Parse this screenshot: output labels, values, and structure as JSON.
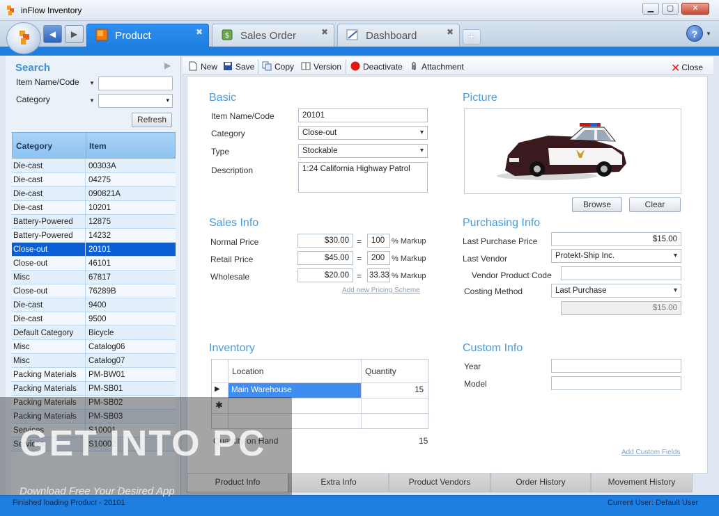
{
  "window": {
    "title": "inFlow Inventory"
  },
  "tabs": [
    {
      "label": "Product"
    },
    {
      "label": "Sales Order"
    },
    {
      "label": "Dashboard"
    }
  ],
  "search": {
    "title": "Search",
    "fields": [
      {
        "label": "Item Name/Code",
        "value": ""
      },
      {
        "label": "Category",
        "value": ""
      }
    ],
    "refresh_label": "Refresh"
  },
  "grid": {
    "headers": [
      "Category",
      "Item"
    ],
    "rows": [
      [
        "Die-cast",
        "00303A"
      ],
      [
        "Die-cast",
        "04275"
      ],
      [
        "Die-cast",
        "090821A"
      ],
      [
        "Die-cast",
        "10201"
      ],
      [
        "Battery-Powered",
        "12875"
      ],
      [
        "Battery-Powered",
        "14232"
      ],
      [
        "Close-out",
        "20101"
      ],
      [
        "Close-out",
        "46101"
      ],
      [
        "Misc",
        "67817"
      ],
      [
        "Close-out",
        "76289B"
      ],
      [
        "Die-cast",
        "9400"
      ],
      [
        "Die-cast",
        "9500"
      ],
      [
        "Default Category",
        "Bicycle"
      ],
      [
        "Misc",
        "Catalog06"
      ],
      [
        "Misc",
        "Catalog07"
      ],
      [
        "Packing Materials",
        "PM-BW01"
      ],
      [
        "Packing Materials",
        "PM-SB01"
      ],
      [
        "Packing Materials",
        "PM-SB02"
      ],
      [
        "Packing Materials",
        "PM-SB03"
      ],
      [
        "Services",
        "S10001"
      ],
      [
        "Services",
        "S10002"
      ]
    ],
    "selected_index": 6
  },
  "toolbar": {
    "new": "New",
    "save": "Save",
    "copy": "Copy",
    "version": "Version",
    "deactivate": "Deactivate",
    "attachment": "Attachment",
    "close": "Close"
  },
  "basic": {
    "title": "Basic",
    "item_label": "Item Name/Code",
    "item_value": "20101",
    "category_label": "Category",
    "category_value": "Close-out",
    "type_label": "Type",
    "type_value": "Stockable",
    "description_label": "Description",
    "description_value": "1:24 California Highway Patrol"
  },
  "picture": {
    "title": "Picture",
    "browse": "Browse",
    "clear": "Clear"
  },
  "sales": {
    "title": "Sales Info",
    "markup_label": "% Markup",
    "rows": [
      {
        "label": "Normal Price",
        "price": "$30.00",
        "markup": "100"
      },
      {
        "label": "Retail Price",
        "price": "$45.00",
        "markup": "200"
      },
      {
        "label": "Wholesale",
        "price": "$20.00",
        "markup": "33.33"
      }
    ],
    "equals": "=",
    "add_scheme": "Add new Pricing Scheme"
  },
  "purchasing": {
    "title": "Purchasing Info",
    "last_price_label": "Last Purchase Price",
    "last_price_value": "$15.00",
    "vendor_label": "Last Vendor",
    "vendor_value": "Protekt-Ship Inc.",
    "vendor_code_label": "Vendor Product Code",
    "vendor_code_value": "",
    "costing_label": "Costing Method",
    "costing_value": "Last Purchase",
    "cost_value": "$15.00"
  },
  "inventory": {
    "title": "Inventory",
    "col_location": "Location",
    "col_quantity": "Quantity",
    "row_location": "Main Warehouse",
    "row_quantity": "15",
    "qoh_label": "Quantity on Hand",
    "qoh_value": "15"
  },
  "custom": {
    "title": "Custom Info",
    "year_label": "Year",
    "year_value": "",
    "model_label": "Model",
    "model_value": "",
    "add_fields": "Add Custom Fields"
  },
  "bottom_tabs": [
    "Product Info",
    "Extra Info",
    "Product Vendors",
    "Order History",
    "Movement History"
  ],
  "status": {
    "message": "Finished loading Product - 20101",
    "user": "Current User:   Default User"
  },
  "watermark": {
    "text": "GET INTO PC",
    "sub": "Download Free Your Desired App"
  },
  "colors": {
    "accent": "#1f7fe0",
    "selection": "#0a5fd6",
    "section_title": "#4a9ad8"
  }
}
